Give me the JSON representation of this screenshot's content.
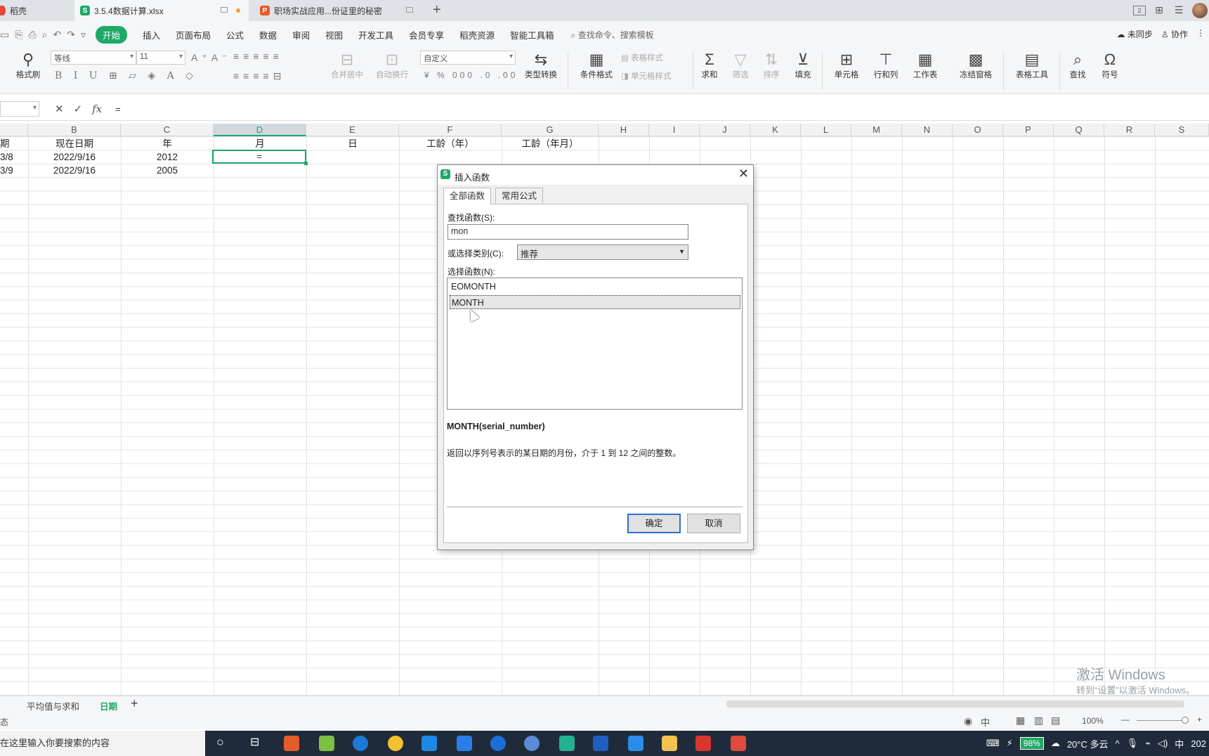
{
  "tabs": [
    {
      "label": "稻壳",
      "color": "#e04a3a"
    },
    {
      "label": "3.5.4数据计算.xlsx",
      "color": "#1fa866",
      "icon": "S"
    },
    {
      "label": "职场实战应用...份证里的秘密",
      "color": "#e8582c",
      "icon": "P"
    }
  ],
  "menu": {
    "items": [
      "开始",
      "插入",
      "页面布局",
      "公式",
      "数据",
      "审阅",
      "视图",
      "开发工具",
      "会员专享",
      "稻壳资源",
      "智能工具箱"
    ],
    "search": "查找命令、搜索模板",
    "sync": "未同步",
    "collab": "协作",
    "accent": "#1fa866"
  },
  "ribbon": {
    "format_painter": "格式刷",
    "font_name": "等线",
    "font_size": "11",
    "merge_center": "合并居中",
    "wrap_text": "自动换行",
    "number_format": "自定义",
    "type_convert": "类型转换",
    "cond_format": "条件格式",
    "table_style": "表格样式",
    "cell_style": "单元格样式",
    "sum": "求和",
    "filter": "筛选",
    "sort": "排序",
    "fill": "填充",
    "cell": "单元格",
    "rowcol": "行和列",
    "worksheet": "工作表",
    "freeze": "冻结窗格",
    "table_tools": "表格工具",
    "find": "查找",
    "symbol": "符号"
  },
  "formula_bar": {
    "value": "="
  },
  "grid": {
    "columns": [
      "B",
      "C",
      "D",
      "E",
      "F",
      "G",
      "H",
      "I",
      "J",
      "K",
      "L",
      "M",
      "N",
      "O",
      "P",
      "Q",
      "R",
      "S"
    ],
    "selected_column": "D",
    "header_row": [
      "期",
      "现在日期",
      "年",
      "月",
      "日",
      "工龄（年）",
      "工龄（年月）"
    ],
    "rows": [
      [
        "3/8",
        "2022/9/16",
        "2012",
        "="
      ],
      [
        "3/9",
        "2022/9/16",
        "2005",
        ""
      ]
    ]
  },
  "sheets": [
    "平均值与求和",
    "日期"
  ],
  "active_sheet": "日期",
  "status": {
    "left": "态",
    "zoom": "100%"
  },
  "watermark": {
    "line1": "激活 Windows",
    "line2": "转到“设置”以激活 Windows。"
  },
  "taskbar": {
    "search_placeholder": "在这里输入你要搜索的内容",
    "battery": "98%",
    "weather": "20°C  多云",
    "ime": "中",
    "clock": "202"
  },
  "dialog": {
    "title": "插入函数",
    "tabs": [
      "全部函数",
      "常用公式"
    ],
    "search_label": "查找函数(S):",
    "search_value": "mon",
    "category_label": "或选择类别(C):",
    "category_value": "推荐",
    "select_label": "选择函数(N):",
    "functions": [
      "EOMONTH",
      "MONTH"
    ],
    "selected_function": "MONTH",
    "signature": "MONTH(serial_number)",
    "description": "返回以序列号表示的某日期的月份，介于 1 到 12 之间的整数。",
    "ok": "确定",
    "cancel": "取消"
  }
}
